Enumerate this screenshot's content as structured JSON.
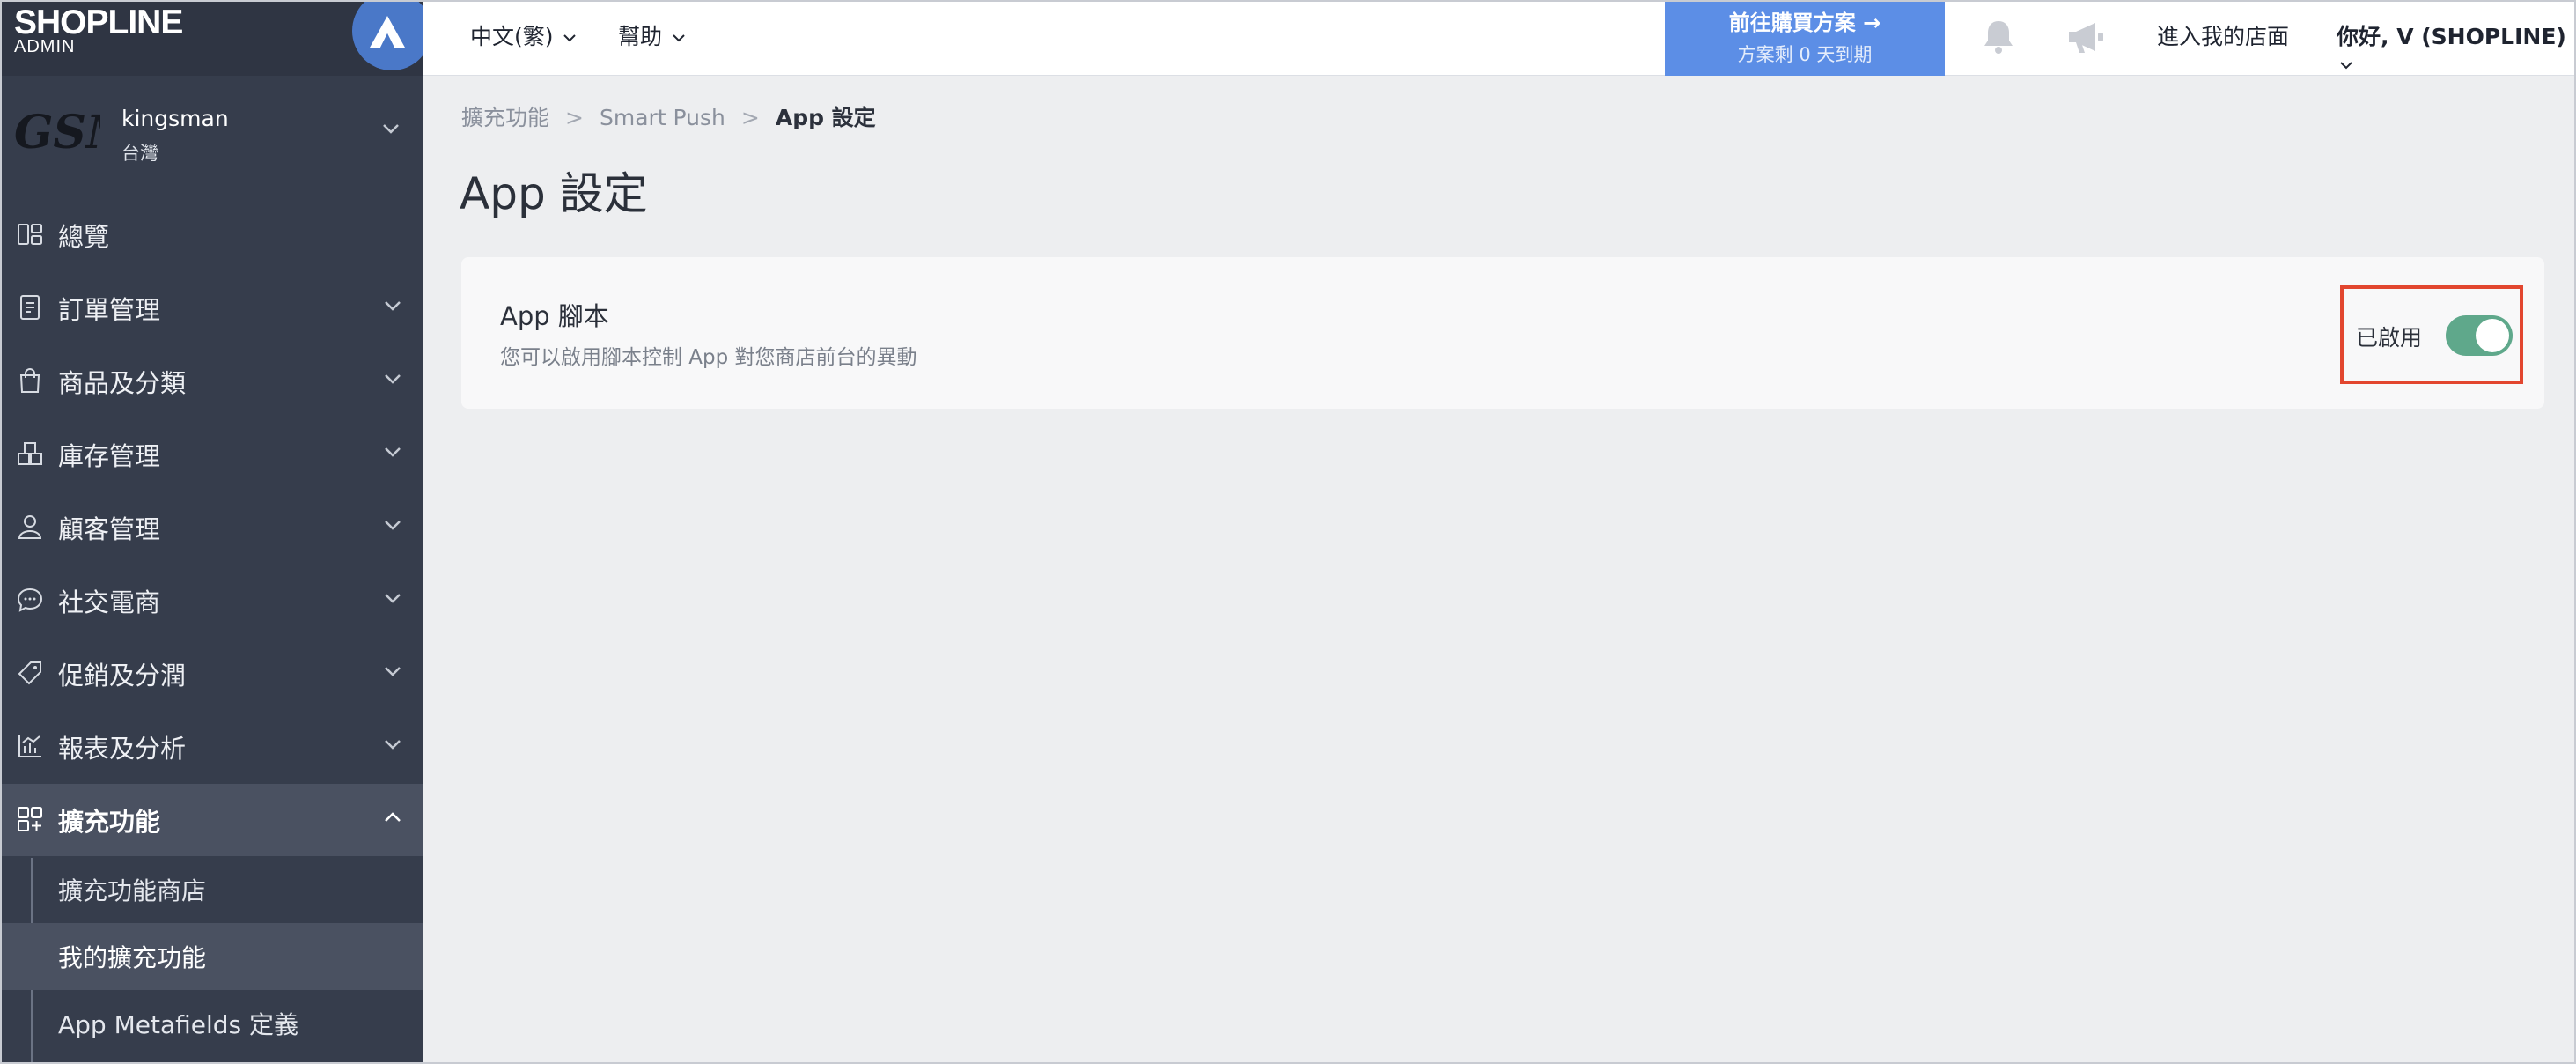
{
  "sidebar": {
    "logo": {
      "brand": "SHOPLINE",
      "sub": "ADMIN"
    },
    "store": {
      "logo_text": "GSM",
      "name": "kingsman",
      "region": "台灣"
    },
    "nav": [
      {
        "label": "總覽",
        "icon": "dashboard-icon"
      },
      {
        "label": "訂單管理",
        "icon": "orders-icon"
      },
      {
        "label": "商品及分類",
        "icon": "bag-icon"
      },
      {
        "label": "庫存管理",
        "icon": "inventory-icon"
      },
      {
        "label": "顧客管理",
        "icon": "user-icon"
      },
      {
        "label": "社交電商",
        "icon": "chat-icon"
      },
      {
        "label": "促銷及分潤",
        "icon": "tag-icon"
      },
      {
        "label": "報表及分析",
        "icon": "chart-icon"
      },
      {
        "label": "擴充功能",
        "icon": "apps-icon"
      }
    ],
    "sub_nav": [
      {
        "label": "擴充功能商店"
      },
      {
        "label": "我的擴充功能"
      },
      {
        "label": "App Metafields 定義"
      }
    ]
  },
  "topbar": {
    "language": "中文(繁)",
    "help": "幫助",
    "plan": {
      "title": "前往購買方案 →",
      "subtitle": "方案剩 0 天到期"
    },
    "visit_store": "進入我的店面",
    "greeting": "你好, V (SHOPLINE)"
  },
  "breadcrumb": [
    "擴充功能",
    "Smart Push",
    "App 設定"
  ],
  "page_title": "App 設定",
  "card": {
    "title": "App 腳本",
    "description": "您可以啟用腳本控制 App 對您商店前台的異動",
    "toggle_status": "已啟用",
    "toggle_on": true
  },
  "colors": {
    "sidebar_bg": "#363d4c",
    "accent_blue": "#5c8ee6",
    "toggle_green": "#5fa88b",
    "highlight_red": "#e2462f"
  }
}
